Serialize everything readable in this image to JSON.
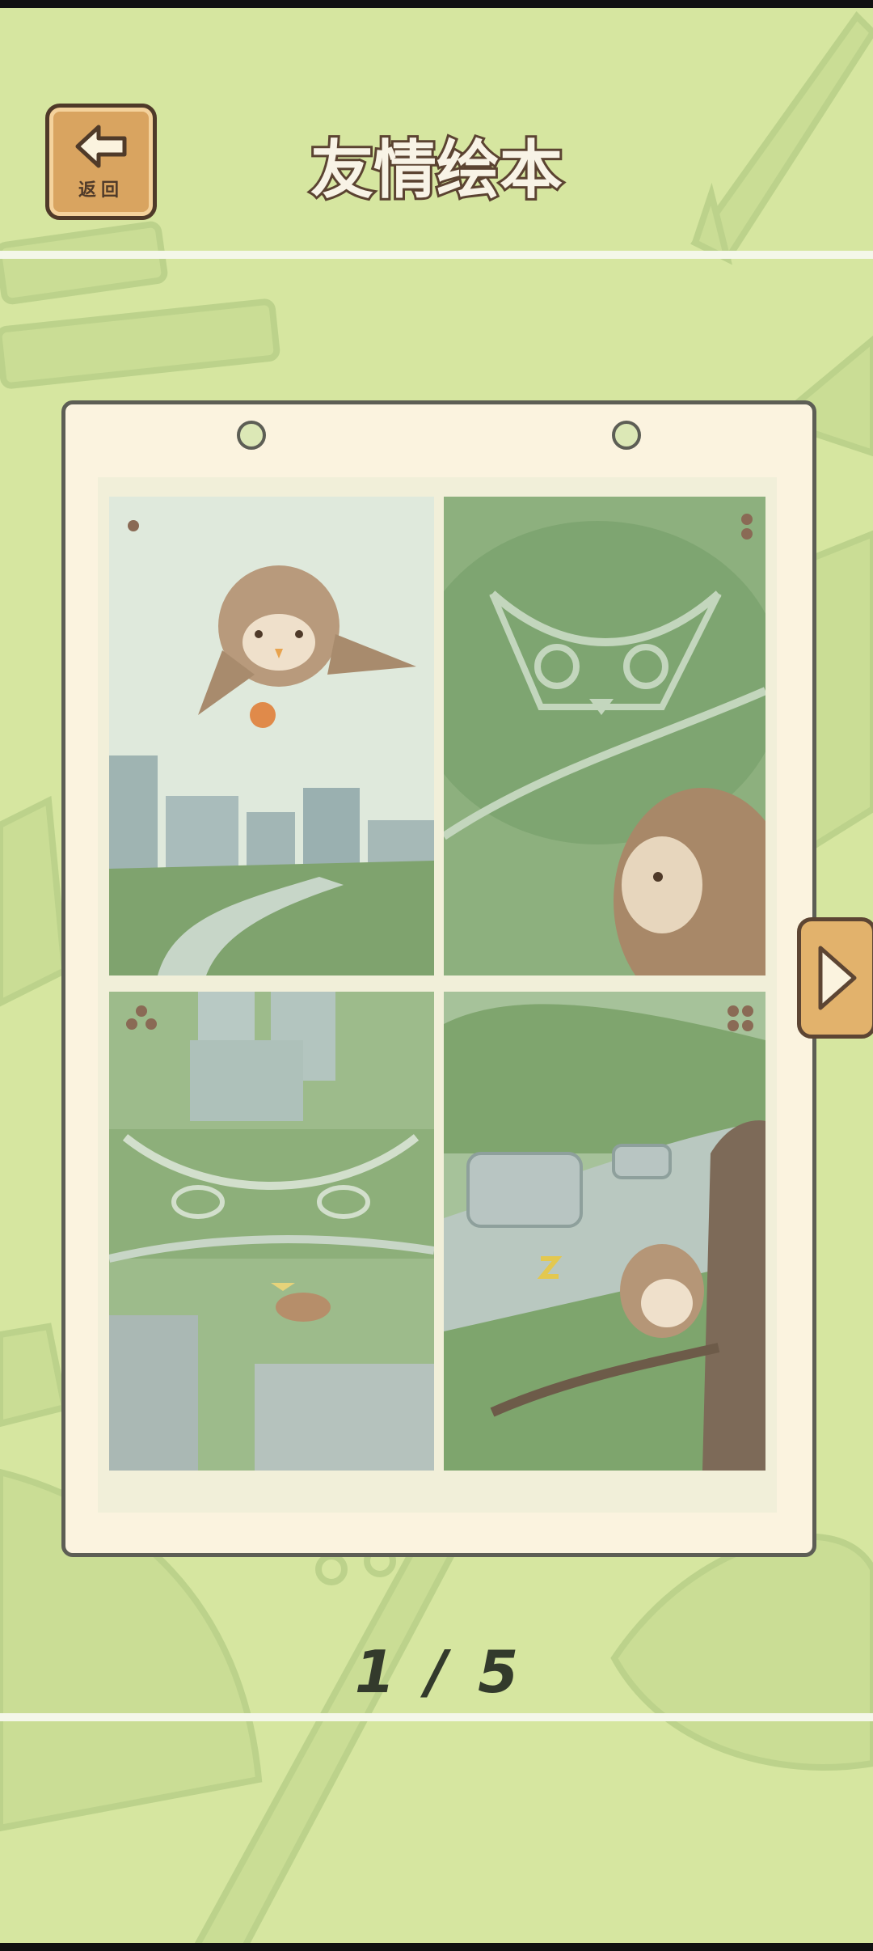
{
  "header": {
    "back_label": "返回",
    "title": "友情绘本"
  },
  "pager": {
    "current": "1",
    "separator": "/",
    "total": "5"
  },
  "panels": [
    {
      "index": 1,
      "marker": "one-dot"
    },
    {
      "index": 2,
      "marker": "two-dots"
    },
    {
      "index": 3,
      "marker": "three-dots"
    },
    {
      "index": 4,
      "marker": "four-dots"
    }
  ],
  "colors": {
    "background": "#d6e6a0",
    "card": "#fbf3df",
    "button_wood": "#d9a460",
    "outline": "#4f3a29"
  },
  "icons": {
    "back": "left-arrow-icon",
    "next": "right-triangle-icon"
  }
}
